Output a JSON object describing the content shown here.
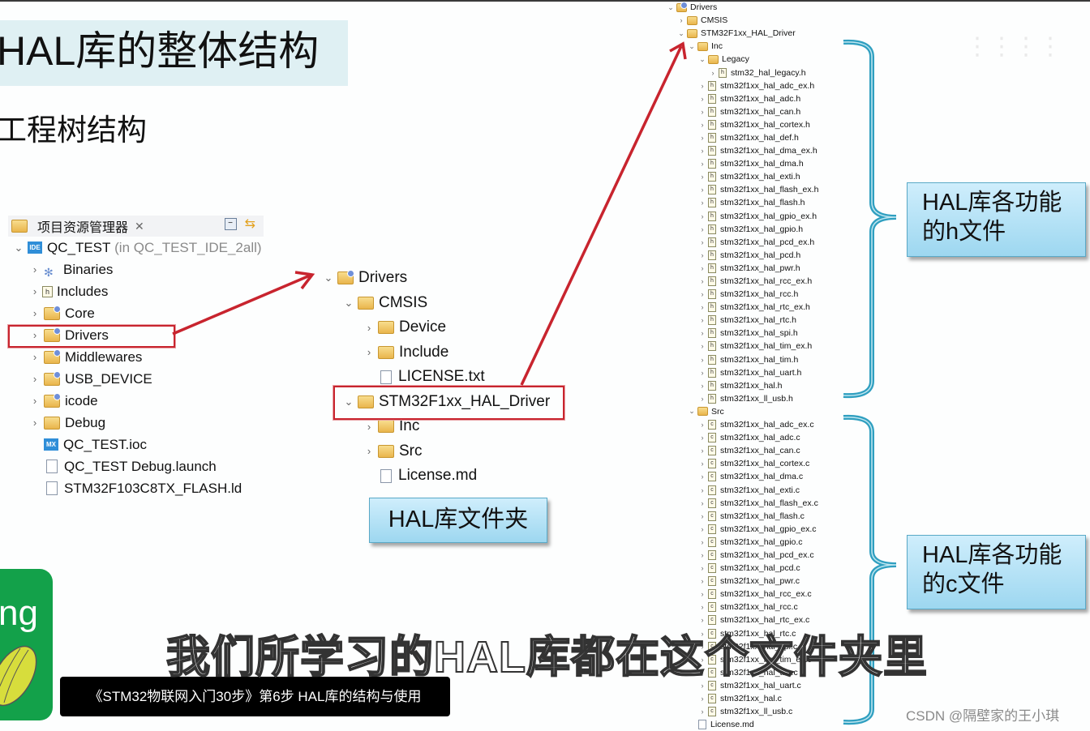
{
  "slide": {
    "title": "HAL库的整体结构",
    "subtitle": "工程树结构"
  },
  "project_explorer": {
    "tab_label": "项目资源管理器",
    "close_glyph": "✕",
    "toolbar": [
      "collapse-all-icon",
      "link-with-editor-icon"
    ],
    "root": {
      "name": "QC_TEST",
      "suffix": "(in QC_TEST_IDE_2all)",
      "icon": "ide-project-icon"
    },
    "items": [
      {
        "label": "Binaries",
        "icon": "binaries-icon",
        "expandable": true
      },
      {
        "label": "Includes",
        "icon": "includes-icon",
        "expandable": true
      },
      {
        "label": "Core",
        "icon": "source-folder-icon",
        "expandable": true
      },
      {
        "label": "Drivers",
        "icon": "source-folder-icon",
        "expandable": true,
        "highlighted": true
      },
      {
        "label": "Middlewares",
        "icon": "source-folder-icon",
        "expandable": true
      },
      {
        "label": "USB_DEVICE",
        "icon": "source-folder-icon",
        "expandable": true
      },
      {
        "label": "icode",
        "icon": "source-folder-icon",
        "expandable": true
      },
      {
        "label": "Debug",
        "icon": "folder-icon",
        "expandable": true
      },
      {
        "label": "QC_TEST.ioc",
        "icon": "mx-file-icon",
        "expandable": false
      },
      {
        "label": "QC_TEST Debug.launch",
        "icon": "file-icon",
        "expandable": false
      },
      {
        "label": "STM32F103C8TX_FLASH.ld",
        "icon": "ld-file-icon",
        "expandable": false
      }
    ]
  },
  "middle_tree": {
    "items": [
      {
        "label": "Drivers",
        "level": 0,
        "state": "expanded"
      },
      {
        "label": "CMSIS",
        "level": 1,
        "state": "expanded"
      },
      {
        "label": "Device",
        "level": 2,
        "state": "collapsed"
      },
      {
        "label": "Include",
        "level": 2,
        "state": "collapsed"
      },
      {
        "label": "LICENSE.txt",
        "level": 2,
        "state": "file"
      },
      {
        "label": "STM32F1xx_HAL_Driver",
        "level": 1,
        "state": "expanded",
        "highlighted": true
      },
      {
        "label": "Inc",
        "level": 2,
        "state": "collapsed"
      },
      {
        "label": "Src",
        "level": 2,
        "state": "collapsed"
      },
      {
        "label": "License.md",
        "level": 2,
        "state": "file"
      }
    ],
    "callout": "HAL库文件夹"
  },
  "right_tree": {
    "header": [
      {
        "label": "Drivers",
        "level": 0,
        "state": "expanded"
      },
      {
        "label": "CMSIS",
        "level": 1,
        "state": "collapsed"
      },
      {
        "label": "STM32F1xx_HAL_Driver",
        "level": 1,
        "state": "expanded"
      },
      {
        "label": "Inc",
        "level": 2,
        "state": "expanded"
      },
      {
        "label": "Legacy",
        "level": 3,
        "state": "expanded"
      },
      {
        "label": "stm32_hal_legacy.h",
        "level": 4,
        "state": "hfile"
      }
    ],
    "inc_files": [
      "stm32f1xx_hal_adc_ex.h",
      "stm32f1xx_hal_adc.h",
      "stm32f1xx_hal_can.h",
      "stm32f1xx_hal_cortex.h",
      "stm32f1xx_hal_def.h",
      "stm32f1xx_hal_dma_ex.h",
      "stm32f1xx_hal_dma.h",
      "stm32f1xx_hal_exti.h",
      "stm32f1xx_hal_flash_ex.h",
      "stm32f1xx_hal_flash.h",
      "stm32f1xx_hal_gpio_ex.h",
      "stm32f1xx_hal_gpio.h",
      "stm32f1xx_hal_pcd_ex.h",
      "stm32f1xx_hal_pcd.h",
      "stm32f1xx_hal_pwr.h",
      "stm32f1xx_hal_rcc_ex.h",
      "stm32f1xx_hal_rcc.h",
      "stm32f1xx_hal_rtc_ex.h",
      "stm32f1xx_hal_rtc.h",
      "stm32f1xx_hal_spi.h",
      "stm32f1xx_hal_tim_ex.h",
      "stm32f1xx_hal_tim.h",
      "stm32f1xx_hal_uart.h",
      "stm32f1xx_hal.h",
      "stm32f1xx_ll_usb.h"
    ],
    "src_label": "Src",
    "src_files": [
      "stm32f1xx_hal_adc_ex.c",
      "stm32f1xx_hal_adc.c",
      "stm32f1xx_hal_can.c",
      "stm32f1xx_hal_cortex.c",
      "stm32f1xx_hal_dma.c",
      "stm32f1xx_hal_exti.c",
      "stm32f1xx_hal_flash_ex.c",
      "stm32f1xx_hal_flash.c",
      "stm32f1xx_hal_gpio_ex.c",
      "stm32f1xx_hal_gpio.c",
      "stm32f1xx_hal_pcd_ex.c",
      "stm32f1xx_hal_pcd.c",
      "stm32f1xx_hal_pwr.c",
      "stm32f1xx_hal_rcc_ex.c",
      "stm32f1xx_hal_rcc.c",
      "stm32f1xx_hal_rtc_ex.c",
      "stm32f1xx_hal_rtc.c",
      "stm32f1xx_hal_spi.c",
      "stm32f1xx_hal_tim_ex.c",
      "stm32f1xx_hal_tim.c",
      "stm32f1xx_hal_uart.c",
      "stm32f1xx_hal.c",
      "stm32f1xx_ll_usb.c"
    ],
    "footer_file": "License.md",
    "callout_h": [
      "HAL库各功能",
      "的h文件"
    ],
    "callout_c": [
      "HAL库各功能",
      "的c文件"
    ]
  },
  "overlay": {
    "logo_text": "ng",
    "video_caption": "《STM32物联网入门30步》第6步 HAL库的结构与使用",
    "subtitle_text": "我们所学习的HAL库都在这个文件夹里",
    "watermark": "CSDN @隔壁家的王小琪"
  },
  "colors": {
    "accent_red": "#c8242e",
    "brace_blue": "#2f9fc0",
    "callout_blue": "#a9dcf2",
    "title_band": "#dff0f3",
    "logo_green": "#13a14a"
  }
}
